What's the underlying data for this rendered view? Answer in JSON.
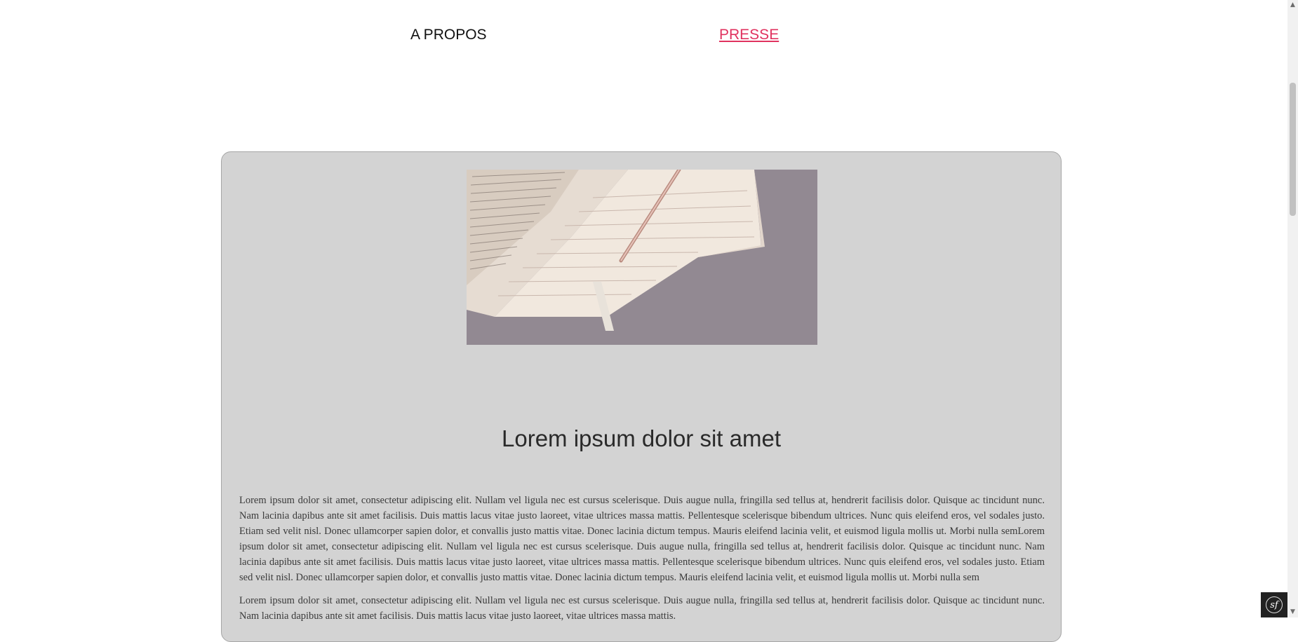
{
  "nav": {
    "about_label": "A PROPOS",
    "press_label": "PRESSE"
  },
  "article": {
    "image_icon": "notebook-pen-photo",
    "title": "Lorem ipsum dolor sit amet",
    "paragraphs": [
      "Lorem ipsum dolor sit amet, consectetur adipiscing elit. Nullam vel ligula nec est cursus scelerisque. Duis augue nulla, fringilla sed tellus at, hendrerit facilisis dolor. Quisque ac tincidunt nunc. Nam lacinia dapibus ante sit amet facilisis. Duis mattis lacus vitae justo laoreet, vitae ultrices massa mattis. Pellentesque scelerisque bibendum ultrices. Nunc quis eleifend eros, vel sodales justo. Etiam sed velit nisl. Donec ullamcorper sapien dolor, et convallis justo mattis vitae. Donec lacinia dictum tempus. Mauris eleifend lacinia velit, et euismod ligula mollis ut. Morbi nulla semLorem ipsum dolor sit amet, consectetur adipiscing elit. Nullam vel ligula nec est cursus scelerisque. Duis augue nulla, fringilla sed tellus at, hendrerit facilisis dolor. Quisque ac tincidunt nunc. Nam lacinia dapibus ante sit amet facilisis. Duis mattis lacus vitae justo laoreet, vitae ultrices massa mattis. Pellentesque scelerisque bibendum ultrices. Nunc quis eleifend eros, vel sodales justo. Etiam sed velit nisl. Donec ullamcorper sapien dolor, et convallis justo mattis vitae. Donec lacinia dictum tempus. Mauris eleifend lacinia velit, et euismod ligula mollis ut. Morbi nulla sem",
      "Lorem ipsum dolor sit amet, consectetur adipiscing elit. Nullam vel ligula nec est cursus scelerisque. Duis augue nulla, fringilla sed tellus at, hendrerit facilisis dolor. Quisque ac tincidunt nunc. Nam lacinia dapibus ante sit amet facilisis. Duis mattis lacus vitae justo laoreet, vitae ultrices massa mattis."
    ]
  },
  "colors": {
    "accent": "#e0325f",
    "card_bg": "#d3d3d3"
  },
  "debug_toolbar": {
    "icon": "symfony-icon",
    "glyph": "sf"
  }
}
